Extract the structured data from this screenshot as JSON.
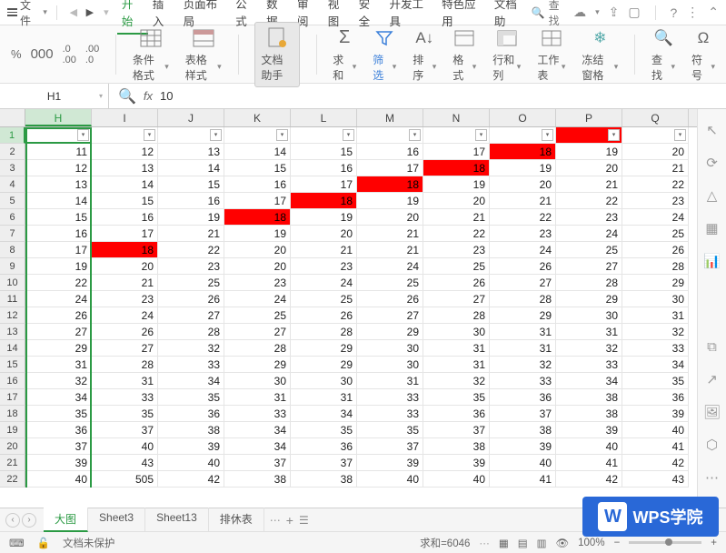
{
  "menu": {
    "file": "文件",
    "tabs": [
      "开始",
      "插入",
      "页面布局",
      "公式",
      "数据",
      "审阅",
      "视图",
      "安全",
      "开发工具",
      "特色应用",
      "文档助"
    ],
    "active_tab": 0,
    "search": "查找"
  },
  "ribbon": {
    "percent": "%",
    "cond_format": "条件格式",
    "table_style": "表格样式",
    "doc_helper": "文档助手",
    "sum": "求和",
    "filter": "筛选",
    "sort": "排序",
    "format": "格式",
    "rowcol": "行和列",
    "worksheet": "工作表",
    "freeze": "冻结窗格",
    "find": "查找",
    "symbol": "符号"
  },
  "formula": {
    "name_box": "H1",
    "value": "10"
  },
  "columns": [
    "H",
    "I",
    "J",
    "K",
    "L",
    "M",
    "N",
    "O",
    "P",
    "Q"
  ],
  "selected_col": 0,
  "rows": [
    1,
    2,
    3,
    4,
    5,
    6,
    7,
    8,
    9,
    10,
    11,
    12,
    13,
    14,
    15,
    16,
    17,
    18,
    19,
    20,
    21,
    22
  ],
  "chart_data": {
    "type": "table",
    "note": "Spreadsheet cell values. Red cells are highlighted (value 18 diagonal, plus P1).",
    "columns": [
      "H",
      "I",
      "J",
      "K",
      "L",
      "M",
      "N",
      "O",
      "P",
      "Q"
    ],
    "data": [
      [
        null,
        null,
        null,
        null,
        null,
        null,
        null,
        null,
        null,
        null
      ],
      [
        11,
        12,
        13,
        14,
        15,
        16,
        17,
        18,
        19,
        20
      ],
      [
        12,
        13,
        14,
        15,
        16,
        17,
        18,
        19,
        20,
        21
      ],
      [
        13,
        14,
        15,
        16,
        17,
        18,
        19,
        20,
        21,
        22
      ],
      [
        14,
        15,
        16,
        17,
        18,
        19,
        20,
        21,
        22,
        23
      ],
      [
        15,
        16,
        19,
        18,
        19,
        20,
        21,
        22,
        23,
        24
      ],
      [
        16,
        17,
        21,
        19,
        20,
        21,
        22,
        23,
        24,
        25
      ],
      [
        17,
        18,
        22,
        20,
        21,
        21,
        23,
        24,
        25,
        26
      ],
      [
        19,
        20,
        23,
        20,
        23,
        24,
        25,
        26,
        27,
        28
      ],
      [
        22,
        21,
        25,
        23,
        24,
        25,
        26,
        27,
        28,
        29
      ],
      [
        24,
        23,
        26,
        24,
        25,
        26,
        27,
        28,
        29,
        30
      ],
      [
        26,
        24,
        27,
        25,
        26,
        27,
        28,
        29,
        30,
        31
      ],
      [
        27,
        26,
        28,
        27,
        28,
        29,
        30,
        31,
        31,
        32
      ],
      [
        29,
        27,
        32,
        28,
        29,
        30,
        31,
        31,
        32,
        33
      ],
      [
        31,
        28,
        33,
        29,
        29,
        30,
        31,
        32,
        33,
        34
      ],
      [
        32,
        31,
        34,
        30,
        30,
        31,
        32,
        33,
        34,
        35
      ],
      [
        34,
        33,
        35,
        31,
        31,
        33,
        35,
        36,
        38,
        36
      ],
      [
        35,
        35,
        36,
        33,
        34,
        33,
        36,
        37,
        38,
        39
      ],
      [
        36,
        37,
        38,
        34,
        35,
        35,
        37,
        38,
        39,
        40
      ],
      [
        37,
        40,
        39,
        34,
        36,
        37,
        38,
        39,
        40,
        41
      ],
      [
        39,
        43,
        40,
        37,
        37,
        39,
        39,
        40,
        41,
        42
      ],
      [
        40,
        505,
        42,
        38,
        38,
        40,
        40,
        41,
        42,
        43
      ]
    ],
    "red_cells": [
      [
        1,
        7
      ],
      [
        2,
        6
      ],
      [
        3,
        5
      ],
      [
        4,
        4
      ],
      [
        5,
        3
      ],
      [
        7,
        1
      ],
      [
        0,
        8
      ]
    ]
  },
  "sheets": {
    "items": [
      "大图",
      "Sheet3",
      "Sheet13",
      "排休表"
    ],
    "active": 0
  },
  "status": {
    "protect": "文档未保护",
    "sum": "求和=6046",
    "zoom": "100%"
  },
  "watermark": "WPS学院"
}
